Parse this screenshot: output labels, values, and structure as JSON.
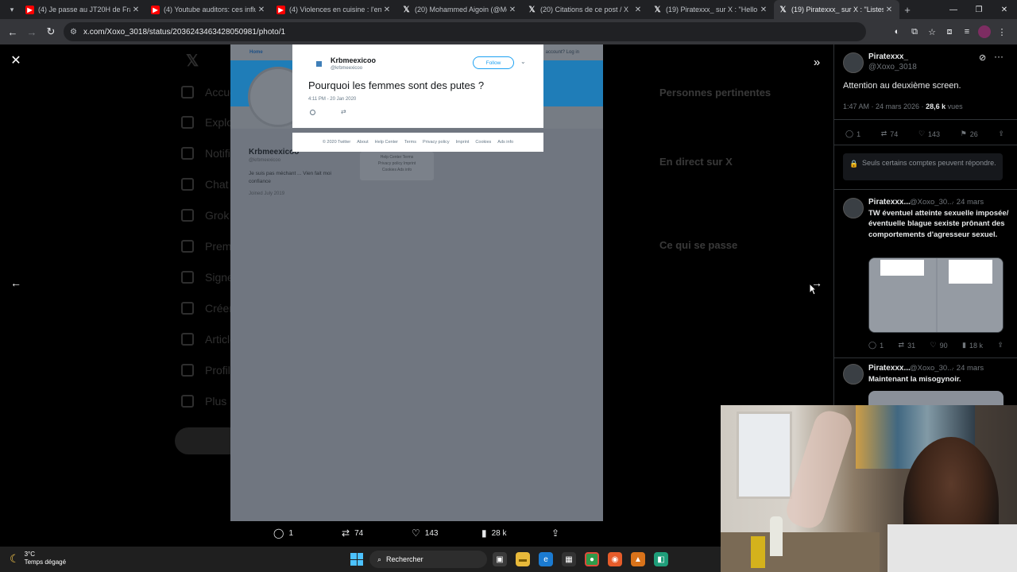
{
  "browser": {
    "tabs": [
      {
        "title": "(4) Je passe au JT20H de France",
        "favicon": "youtube-icon"
      },
      {
        "title": "(4) Youtube auditors: ces influen",
        "favicon": "youtube-icon"
      },
      {
        "title": "(4) Violences en cuisine : l'enfe",
        "favicon": "youtube-icon"
      },
      {
        "title": "(20) Mohammed Aigoin (@Mo",
        "favicon": "x-icon"
      },
      {
        "title": "(20) Citations de ce post / X",
        "favicon": "x-icon"
      },
      {
        "title": "(19) Piratexxx_ sur X : \"Hello to",
        "favicon": "x-icon"
      },
      {
        "title": "(19) Piratexxx_ sur X : \"Listes de",
        "favicon": "x-icon",
        "active": true
      }
    ],
    "url": "x.com/Xoxo_3018/status/2036243463428050981/photo/1"
  },
  "background": {
    "nav_items": [
      "Accueil",
      "Explorer",
      "Notifications",
      "Chat",
      "Grok",
      "Premium",
      "Signets",
      "Créer",
      "Articles",
      "Profil",
      "Plus"
    ],
    "right_headings": [
      "Personnes pertinentes",
      "En direct sur X",
      "Ce qui se passe"
    ]
  },
  "photo": {
    "topbar_home": "Home",
    "topbar_login": "account? Log in",
    "profile_name": "Krbmeexicoo",
    "profile_handle": "@krbmeexicoo",
    "profile_bio": "Je suis pas méchant ... Vien fait moi confiance",
    "profile_joined": "Joined July 2019",
    "sidebox_lines": [
      "Help Center  Terms",
      "Privacy policy  Imprint",
      "Cookies  Ads info"
    ],
    "tweet": {
      "name": "Krbmeexicoo",
      "handle": "@krbmeexicoo",
      "follow": "Follow",
      "text": "Pourquoi les femmes sont des putes ?",
      "date": "4:11 PM - 20 Jan 2020"
    },
    "footer_links": [
      "© 2020 Twitter",
      "About",
      "Help Center",
      "Terms",
      "Privacy policy",
      "Imprint",
      "Cookies",
      "Ads info"
    ]
  },
  "viewer_actions": {
    "replies": "1",
    "reposts": "74",
    "likes": "143",
    "views": "28 k"
  },
  "thread": {
    "main": {
      "name": "Piratexxx_",
      "handle": "@Xoxo_3018",
      "text": "Attention au deuxième screen.",
      "time": "1:47 AM · 24 mars 2026 · ",
      "views_count": "28,6 k",
      "views_label": " vues",
      "replies": "1",
      "reposts": "74",
      "likes": "143",
      "bookmarks": "26",
      "notice": "Seuls certains comptes peuvent répondre."
    },
    "reply1": {
      "name": "Piratexxx...",
      "handle": "@Xoxo_30...",
      "time": "· 24 mars",
      "text": "TW éventuel atteinte sexuelle imposée/ éventuelle blague sexiste prônant des comportements d'agresseur sexuel.",
      "replies": "1",
      "reposts": "31",
      "likes": "90",
      "views": "18 k"
    },
    "reply2": {
      "name": "Piratexxx...",
      "handle": "@Xoxo_30...",
      "time": "· 24 mars",
      "text": "Maintenant la misogynoir."
    }
  },
  "taskbar": {
    "temp": "3°C",
    "weather": "Temps dégagé",
    "search": "Rechercher"
  },
  "colors": {
    "accent_blue": "#1da1f2",
    "x_background": "#000000",
    "chrome_dark": "#202124"
  }
}
